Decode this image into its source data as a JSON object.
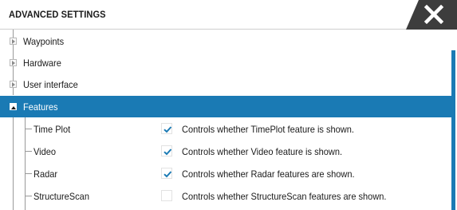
{
  "dialog": {
    "title": "ADVANCED SETTINGS",
    "close_icon": "close-x-icon"
  },
  "tree": {
    "categories": [
      {
        "label": "Waypoints",
        "expanded": false
      },
      {
        "label": "Hardware",
        "expanded": false
      },
      {
        "label": "User interface",
        "expanded": false
      },
      {
        "label": "Features",
        "expanded": true,
        "selected": true
      }
    ],
    "features": [
      {
        "label": "Time Plot",
        "checked": true,
        "description": "Controls whether TimePlot feature is shown."
      },
      {
        "label": "Video",
        "checked": true,
        "description": "Controls whether Video feature is shown."
      },
      {
        "label": "Radar",
        "checked": true,
        "description": "Controls whether Radar features are shown."
      },
      {
        "label": "StructureScan",
        "checked": false,
        "description": "Controls whether StructureScan features are shown."
      }
    ]
  },
  "colors": {
    "accent": "#1a7ab4",
    "close_button": "#3d3d3d",
    "check": "#1a7ab4"
  }
}
